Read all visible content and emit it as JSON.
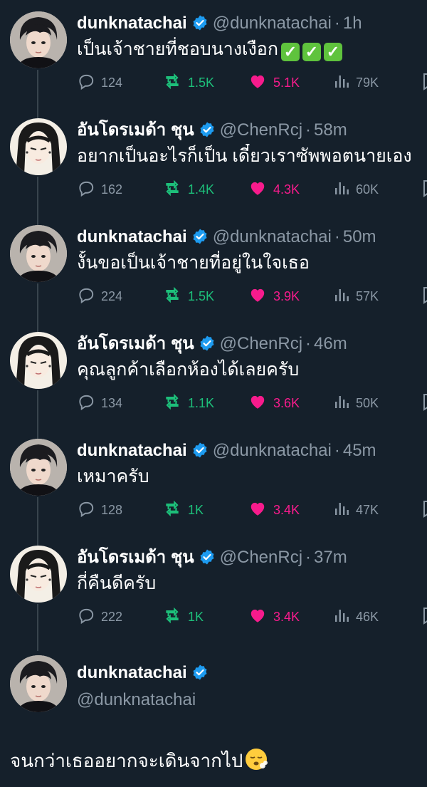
{
  "colors": {
    "background": "#15202b",
    "secondary_text": "#8b98a5",
    "retweet": "#1dbf7a",
    "like": "#f71b8c",
    "verified": "#1d9bf0"
  },
  "tweets": [
    {
      "name": "dunknatachai",
      "handle": "@dunknatachai",
      "dot": "·",
      "time": "1h",
      "text": "เป็นเจ้าชายที่ชอบนางเงือก",
      "checks": [
        "✓",
        "✓",
        "✓"
      ],
      "replies": "124",
      "retweets": "1.5K",
      "likes": "5.1K",
      "views": "79K",
      "avatar": "avatar-dunk"
    },
    {
      "name": "อันโดรเมด้า ชุน",
      "handle": "@ChenRcj",
      "dot": "·",
      "time": "58m",
      "text": "อยากเป็นอะไรก็เป็น เดี๋ยวเราซัพพอตนายเอง",
      "replies": "162",
      "retweets": "1.4K",
      "likes": "4.3K",
      "views": "60K",
      "avatar": "avatar-chen"
    },
    {
      "name": "dunknatachai",
      "handle": "@dunknatachai",
      "dot": "·",
      "time": "50m",
      "text": "งั้นขอเป็นเจ้าชายที่อยู่ในใจเธอ",
      "replies": "224",
      "retweets": "1.5K",
      "likes": "3.9K",
      "views": "57K",
      "avatar": "avatar-dunk"
    },
    {
      "name": "อันโดรเมด้า ชุน",
      "handle": "@ChenRcj",
      "dot": "·",
      "time": "46m",
      "text": "คุณลูกค้าเลือกห้องได้เลยครับ",
      "replies": "134",
      "retweets": "1.1K",
      "likes": "3.6K",
      "views": "50K",
      "avatar": "avatar-chen"
    },
    {
      "name": "dunknatachai",
      "handle": "@dunknatachai",
      "dot": "·",
      "time": "45m",
      "text": "เหมาครับ",
      "replies": "128",
      "retweets": "1K",
      "likes": "3.4K",
      "views": "47K",
      "avatar": "avatar-dunk"
    },
    {
      "name": "อันโดรเมด้า ชุน",
      "handle": "@ChenRcj",
      "dot": "·",
      "time": "37m",
      "text": "กี่คืนดีครับ",
      "replies": "222",
      "retweets": "1K",
      "likes": "3.4K",
      "views": "46K",
      "avatar": "avatar-chen"
    }
  ],
  "main_tweet": {
    "name": "dunknatachai",
    "handle": "@dunknatachai",
    "text": "จนกว่าเธออยากจะเดินจากไป",
    "emoji": "face-exhaling-emoji"
  },
  "icons": {
    "reply": "reply-icon",
    "retweet": "retweet-icon",
    "like": "heart-icon",
    "views": "views-icon",
    "share": "share-icon",
    "verified": "verified-badge-icon"
  }
}
